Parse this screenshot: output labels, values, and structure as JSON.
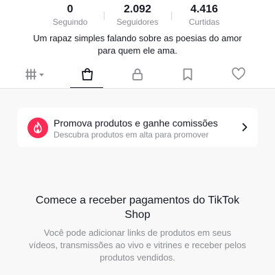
{
  "profile": {
    "stats": [
      {
        "value": "0",
        "label": "Seguindo"
      },
      {
        "value": "2.092",
        "label": "Seguidores"
      },
      {
        "value": "4.416",
        "label": "Curtidas"
      }
    ],
    "bio_line1": "Um rapaz simples falando sobre as poesias do amor",
    "bio_line2": "para quem ele ama."
  },
  "tabs": [
    {
      "icon": "grid-icon",
      "active": false
    },
    {
      "icon": "shopping-bag-icon",
      "active": true
    },
    {
      "icon": "lock-icon",
      "active": false
    },
    {
      "icon": "bookmark-icon",
      "active": false
    },
    {
      "icon": "heart-icon",
      "active": false
    }
  ],
  "promo": {
    "icon": "flame-icon",
    "title": "Promova produtos e ganhe comissões",
    "subtitle": "Descubra produtos em alta para promover"
  },
  "empty_state": {
    "title_line1": "Comece a receber pagamentos do TikTok",
    "title_line2": "Shop",
    "desc_line1": "Você pode adicionar links de produtos em seus",
    "desc_line2": "vídeos, transmissões ao vivo e vitrines e receber pelos",
    "desc_line3": "produtos vendidos."
  },
  "colors": {
    "accent": "#fe2c55",
    "text": "#161823",
    "muted": "#8a8b91",
    "background": "#f8f8f8"
  }
}
